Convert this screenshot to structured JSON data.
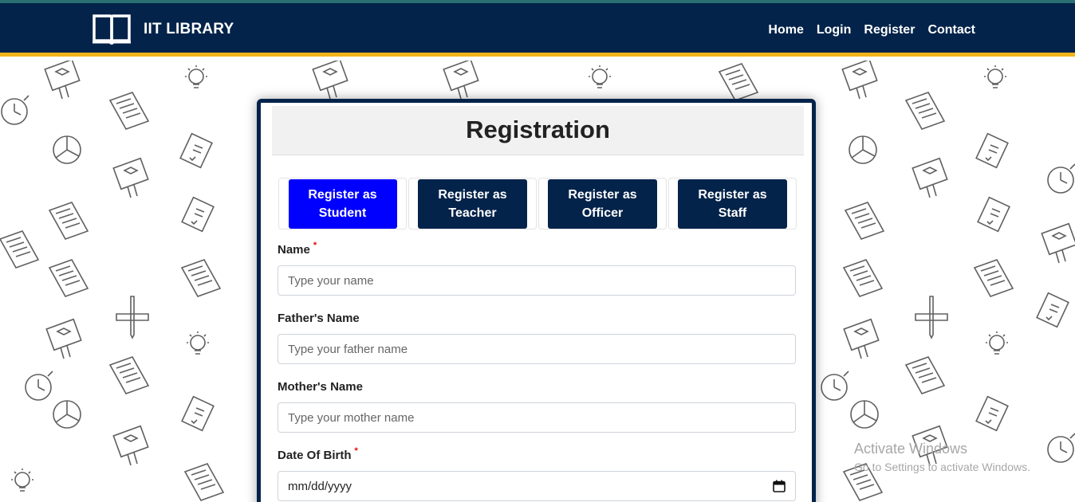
{
  "navbar": {
    "brand": "IIT LIBRARY",
    "links": [
      "Home",
      "Login",
      "Register",
      "Contact"
    ],
    "colors": {
      "bg": "#03234a",
      "accent": "#f3b41b"
    }
  },
  "card": {
    "title": "Registration",
    "tabs": [
      {
        "label": "Register as\nStudent",
        "active": true
      },
      {
        "label": "Register as\nTeacher",
        "active": false
      },
      {
        "label": "Register as\nOfficer",
        "active": false
      },
      {
        "label": "Register as\nStaff",
        "active": false
      }
    ]
  },
  "form": {
    "name": {
      "label": "Name",
      "required_mark": "*",
      "placeholder": "Type your name"
    },
    "father": {
      "label": "Father's Name",
      "placeholder": "Type your father name"
    },
    "mother": {
      "label": "Mother's Name",
      "placeholder": "Type your mother name"
    },
    "dob": {
      "label": "Date Of Birth",
      "required_mark": "*",
      "value": "mm/dd/yyyy",
      "icon": "calendar-icon"
    }
  },
  "watermark": {
    "title": "Activate Windows",
    "subtitle": "Go to Settings to activate Windows."
  }
}
